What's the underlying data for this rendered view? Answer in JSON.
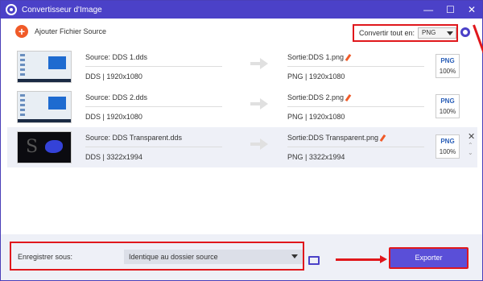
{
  "window": {
    "title": "Convertisseur d'Image",
    "controls": [
      "—",
      "☐",
      "✕"
    ]
  },
  "toolbar": {
    "add_label": "Ajouter Fichier Source",
    "convert_all_label": "Convertir tout en:",
    "convert_all_value": "PNG"
  },
  "files": [
    {
      "source": "Source: DDS 1.dds",
      "source_format": "DDS",
      "source_resolution": "1920x1080",
      "output": "Sortie:DDS 1.png",
      "output_format": "PNG",
      "output_resolution": "1920x1080",
      "badge_format": "PNG",
      "badge_quality": "100%"
    },
    {
      "source": "Source: DDS 2.dds",
      "source_format": "DDS",
      "source_resolution": "1920x1080",
      "output": "Sortie:DDS 2.png",
      "output_format": "PNG",
      "output_resolution": "1920x1080",
      "badge_format": "PNG",
      "badge_quality": "100%"
    },
    {
      "source": "Source: DDS Transparent.dds",
      "source_format": "DDS",
      "source_resolution": "3322x1994",
      "output": "Sortie:DDS Transparent.png",
      "output_format": "PNG",
      "output_resolution": "3322x1994",
      "badge_format": "PNG",
      "badge_quality": "100%"
    }
  ],
  "bottom": {
    "save_label": "Enregistrer sous:",
    "save_value": "Identique au dossier source",
    "export_label": "Exporter"
  },
  "colors": {
    "accent": "#4b41c8",
    "highlight": "#e0171c",
    "add": "#f05a28"
  }
}
